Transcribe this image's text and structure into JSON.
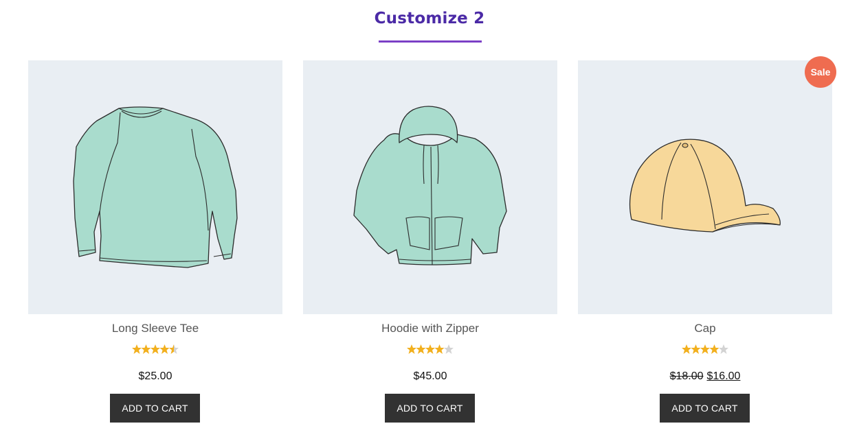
{
  "section": {
    "heading": "Customize 2",
    "accent_color": "#7b3fc6"
  },
  "products": [
    {
      "title": "Long Sleeve Tee",
      "rating": 4.5,
      "price": "$25.00",
      "image": "long-sleeve-tee-illustration",
      "button_label": "ADD TO CART"
    },
    {
      "title": "Hoodie with Zipper",
      "rating": 4,
      "price": "$45.00",
      "image": "hoodie-illustration",
      "button_label": "ADD TO CART"
    },
    {
      "title": "Cap",
      "rating": 4,
      "price_regular": "$18.00",
      "price_sale": "$16.00",
      "badge": "Sale",
      "image": "cap-illustration",
      "button_label": "ADD TO CART"
    }
  ],
  "colors": {
    "star_fill": "#f2b01e",
    "star_empty": "#d3d3d3",
    "badge": "#ef6c50",
    "button": "#323232",
    "thumb_bg": "#e9eef3"
  }
}
